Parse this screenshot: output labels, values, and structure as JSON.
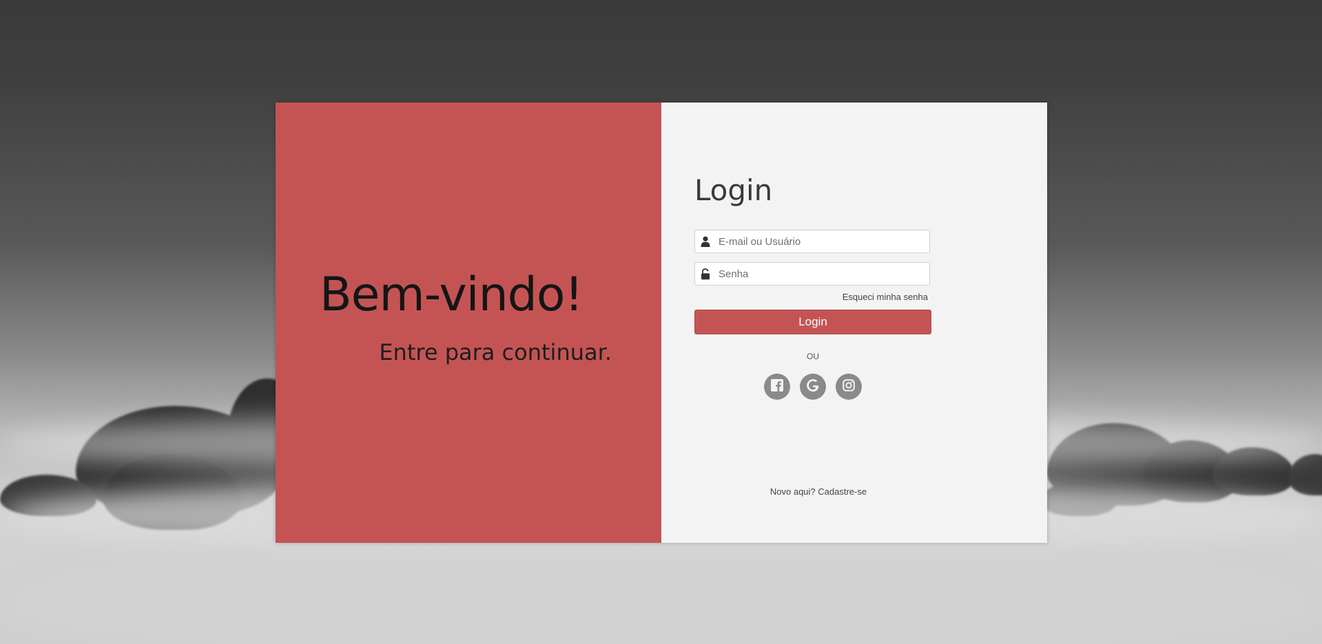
{
  "welcome": {
    "title": "Bem-vindo!",
    "subtitle": "Entre para continuar."
  },
  "login": {
    "title": "Login",
    "email_placeholder": "E-mail ou Usuário",
    "password_placeholder": "Senha",
    "forgot_password": "Esqueci minha senha",
    "submit_label": "Login",
    "or_text": "OU",
    "social": [
      {
        "name": "facebook-icon"
      },
      {
        "name": "google-icon"
      },
      {
        "name": "instagram-icon"
      }
    ],
    "register_prompt": "Novo aqui? ",
    "register_link": "Cadastre-se"
  },
  "colors": {
    "accent": "#c45454",
    "panel_bg": "#f3f3f3",
    "social_bg": "#8a8a8a"
  }
}
